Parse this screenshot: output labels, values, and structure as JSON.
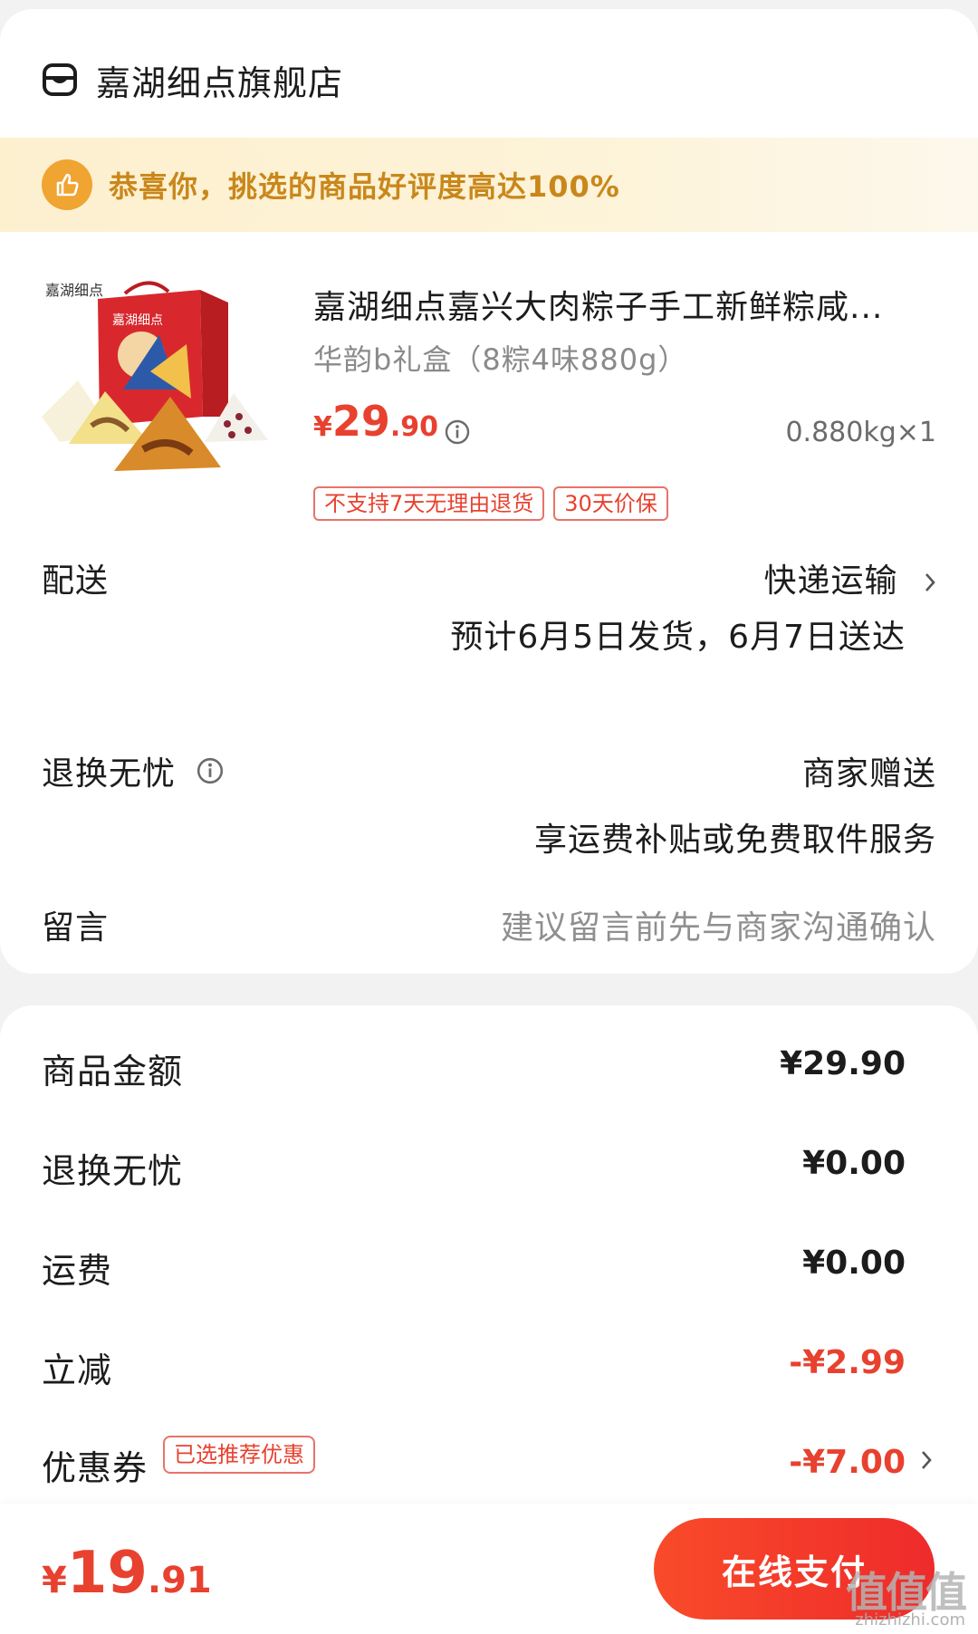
{
  "store": {
    "name": "嘉湖细点旗舰店",
    "icon": "store-icon"
  },
  "banner": {
    "text": "恭喜你，挑选的商品好评度高达100%",
    "icon": "thumbs-up-icon",
    "color": "#f0a431"
  },
  "product": {
    "title": "嘉湖细点嘉兴大肉粽子手工新鲜粽咸...",
    "spec": "华韵b礼盒（8粽4味880g）",
    "price": {
      "yen": "¥",
      "int": "29",
      "dec": ".90"
    },
    "quantity": "0.880kg×1",
    "tags": [
      "不支持7天无理由退货",
      "30天价保"
    ],
    "image_brand": "嘉湖细点"
  },
  "delivery": {
    "label": "配送",
    "method": "快递运输",
    "estimate": "预计6月5日发货，6月7日送达"
  },
  "returns": {
    "label": "退换无忧",
    "value": "商家赠送",
    "desc": "享运费补贴或免费取件服务"
  },
  "message": {
    "label": "留言",
    "placeholder": "建议留言前先与商家沟通确认"
  },
  "summary": {
    "goods_label": "商品金额",
    "goods_value": "¥29.90",
    "returns_label": "退换无忧",
    "returns_value": "¥0.00",
    "shipping_label": "运费",
    "shipping_value": "¥0.00",
    "discount_label": "立减",
    "discount_value": "-¥2.99",
    "coupon_label": "优惠券",
    "coupon_tag": "已选推荐优惠",
    "coupon_value": "-¥7.00"
  },
  "footer": {
    "total": {
      "yen": "¥",
      "int": "19",
      "dec": ".91"
    },
    "pay_label": "在线支付",
    "watermark": "值值值",
    "watermark_url": "zhizhizhi.com"
  },
  "colors": {
    "accent": "#e8412f",
    "banner_text": "#c9871b",
    "muted": "#8f8f8f"
  }
}
